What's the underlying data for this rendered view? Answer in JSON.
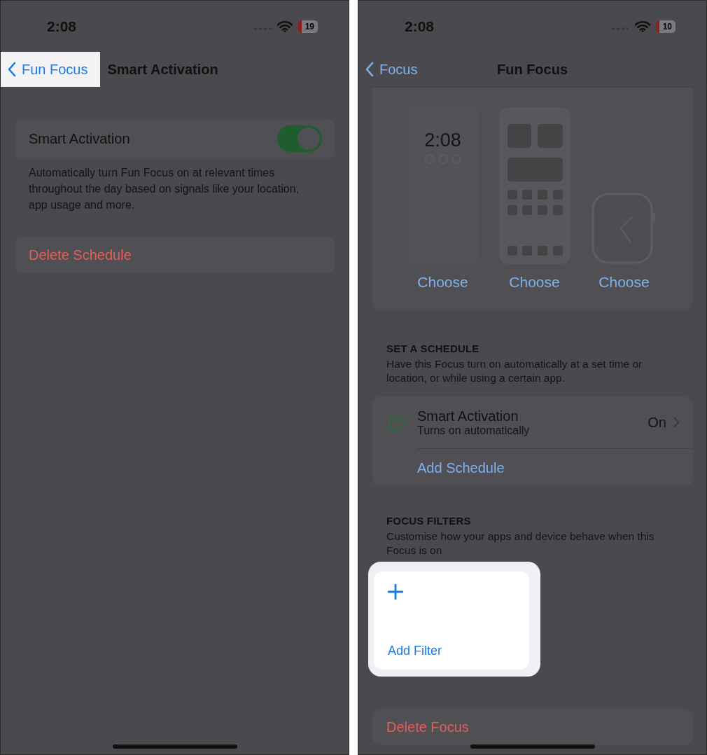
{
  "left_screen": {
    "status_bar": {
      "time": "2:08",
      "battery": "19"
    },
    "nav": {
      "back": {
        "label": "Fun Focus",
        "highlighted": true
      },
      "title": "Smart Activation"
    },
    "toggle_row": {
      "label": "Smart Activation",
      "on": true
    },
    "footer": "Automatically turn Fun Focus on at relevant times throughout the day based on signals like your location, app usage and more.",
    "delete_button": "Delete Schedule"
  },
  "right_screen": {
    "status_bar": {
      "time": "2:08",
      "battery": "10"
    },
    "nav": {
      "back": {
        "label": "Focus",
        "highlighted": false
      },
      "title": "Fun Focus"
    },
    "screens": [
      {
        "kind": "lock_screen",
        "clock": "2:08",
        "label": "Choose"
      },
      {
        "kind": "home_screen",
        "label": "Choose"
      },
      {
        "kind": "watch",
        "label": "Choose"
      }
    ],
    "schedule": {
      "header": "SET A SCHEDULE",
      "description": "Have this Focus turn on automatically at a set time or location, or while using a certain app.",
      "items": [
        {
          "title": "Smart Activation",
          "subtitle": "Turns on automatically",
          "value": "On"
        }
      ],
      "add_label": "Add Schedule"
    },
    "filters": {
      "header": "FOCUS FILTERS",
      "description": "Customise how your apps and device behave when this Focus is on",
      "add_filter": {
        "label": "Add Filter",
        "highlighted": true
      }
    },
    "delete_button": "Delete Focus"
  }
}
